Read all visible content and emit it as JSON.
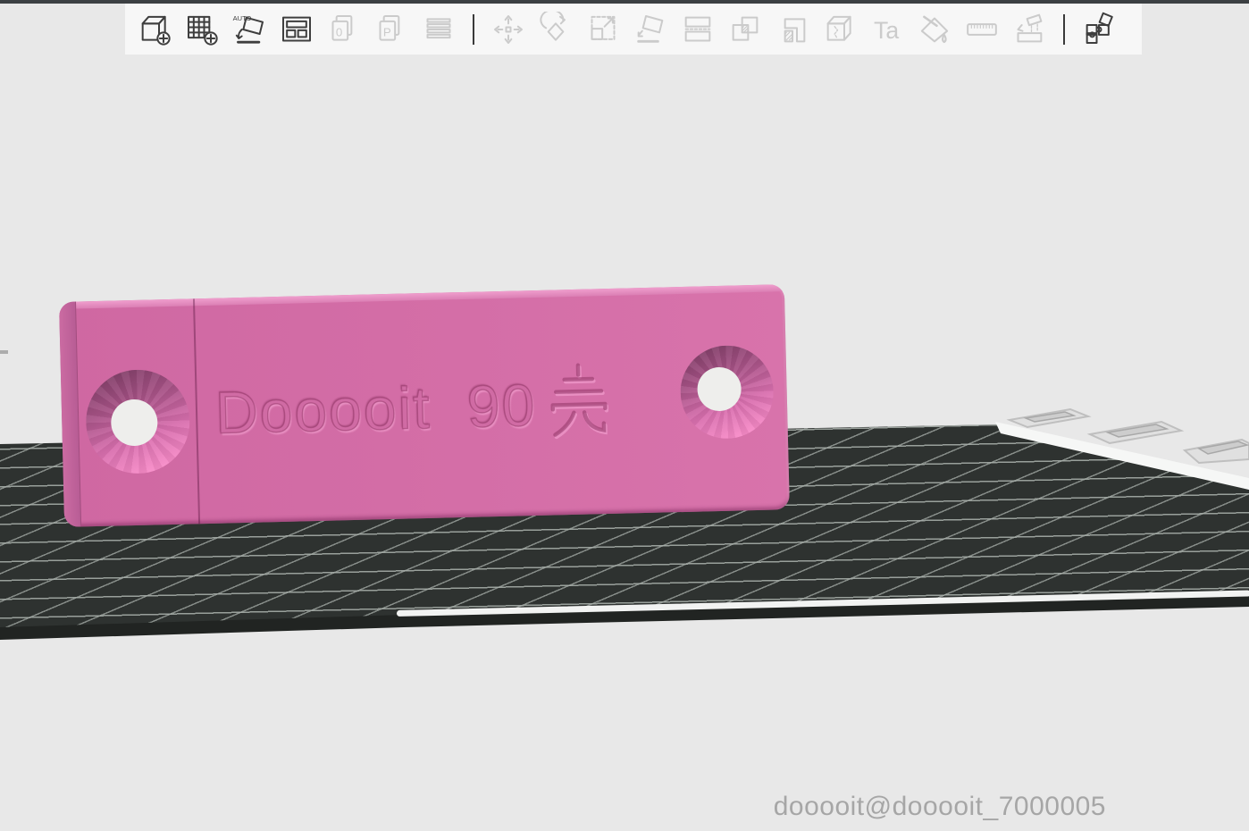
{
  "toolbar": {
    "groups": [
      {
        "items": [
          {
            "name": "add-model",
            "enabled": true
          },
          {
            "name": "add-plate",
            "enabled": true
          },
          {
            "name": "auto-orient",
            "enabled": true,
            "label": "AUTO"
          },
          {
            "name": "arrange",
            "enabled": true
          },
          {
            "name": "import-object-zero",
            "enabled": false,
            "label": "0"
          },
          {
            "name": "import-object-p",
            "enabled": false,
            "label": "P"
          },
          {
            "name": "variable-layer-height",
            "enabled": false
          }
        ]
      },
      {
        "items": [
          {
            "name": "move",
            "enabled": false
          },
          {
            "name": "rotate",
            "enabled": false
          },
          {
            "name": "scale",
            "enabled": false
          },
          {
            "name": "place-on-face",
            "enabled": false
          },
          {
            "name": "cut",
            "enabled": false
          },
          {
            "name": "mesh-boolean",
            "enabled": false
          },
          {
            "name": "support-painting",
            "enabled": false
          },
          {
            "name": "seam-painting",
            "enabled": false
          },
          {
            "name": "text-tool",
            "enabled": false,
            "label": "Ta"
          },
          {
            "name": "color-painting",
            "enabled": false
          },
          {
            "name": "measure",
            "enabled": false
          },
          {
            "name": "lower-to-bed",
            "enabled": false
          }
        ]
      },
      {
        "items": [
          {
            "name": "assembly-plugin",
            "enabled": true
          }
        ]
      }
    ]
  },
  "viewport": {
    "background": "#e8e8e8",
    "watermark": "dooooit@dooooit_7000005"
  },
  "build_plate": {
    "surface_color": "#2e3230",
    "grid_color": "#a8afaa",
    "edge_highlight_color": "#f2f3f2",
    "edge_glyphs": "diamond-markings"
  },
  "model": {
    "kind": "nameplate-3d-model",
    "color": "#d26ba5",
    "engraving_text": "Dooooit 90",
    "engraving_cjk": "壳",
    "engraving_full": "Dooooit 90壳",
    "features": [
      "countersunk-hole-left",
      "countersunk-hole-right",
      "part-seam"
    ]
  }
}
